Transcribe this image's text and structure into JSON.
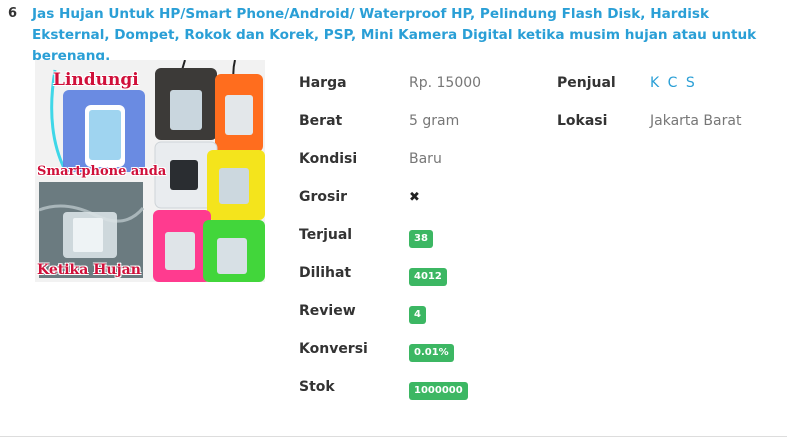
{
  "listing": {
    "rank": "6",
    "title": "Jas Hujan Untuk HP/Smart Phone/Android/ Waterproof HP, Pelindung Flash Disk, Hardisk Eksternal, Dompet, Rokok dan Korek, PSP, Mini Kamera Digital ketika musim hujan atau untuk berenang.",
    "image_texts": [
      "Lindungi",
      "Smartphone anda",
      "Ketika Hujan"
    ],
    "details": {
      "price_label": "Harga",
      "price_value": "Rp. 15000",
      "weight_label": "Berat",
      "weight_value": "5 gram",
      "condition_label": "Kondisi",
      "condition_value": "Baru",
      "wholesale_label": "Grosir",
      "wholesale_value": "✖",
      "sold_label": "Terjual",
      "sold_value": "38",
      "views_label": "Dilihat",
      "views_value": "4012",
      "review_label": "Review",
      "review_value": "4",
      "conversion_label": "Konversi",
      "conversion_value": "0.01%",
      "stock_label": "Stok",
      "stock_value": "1000000"
    },
    "seller": {
      "seller_label": "Penjual",
      "seller_value": "K C S",
      "location_label": "Lokasi",
      "location_value": "Jakarta Barat"
    },
    "colors": {
      "accent": "#2a9fd6",
      "badge": "#3cb763"
    }
  }
}
